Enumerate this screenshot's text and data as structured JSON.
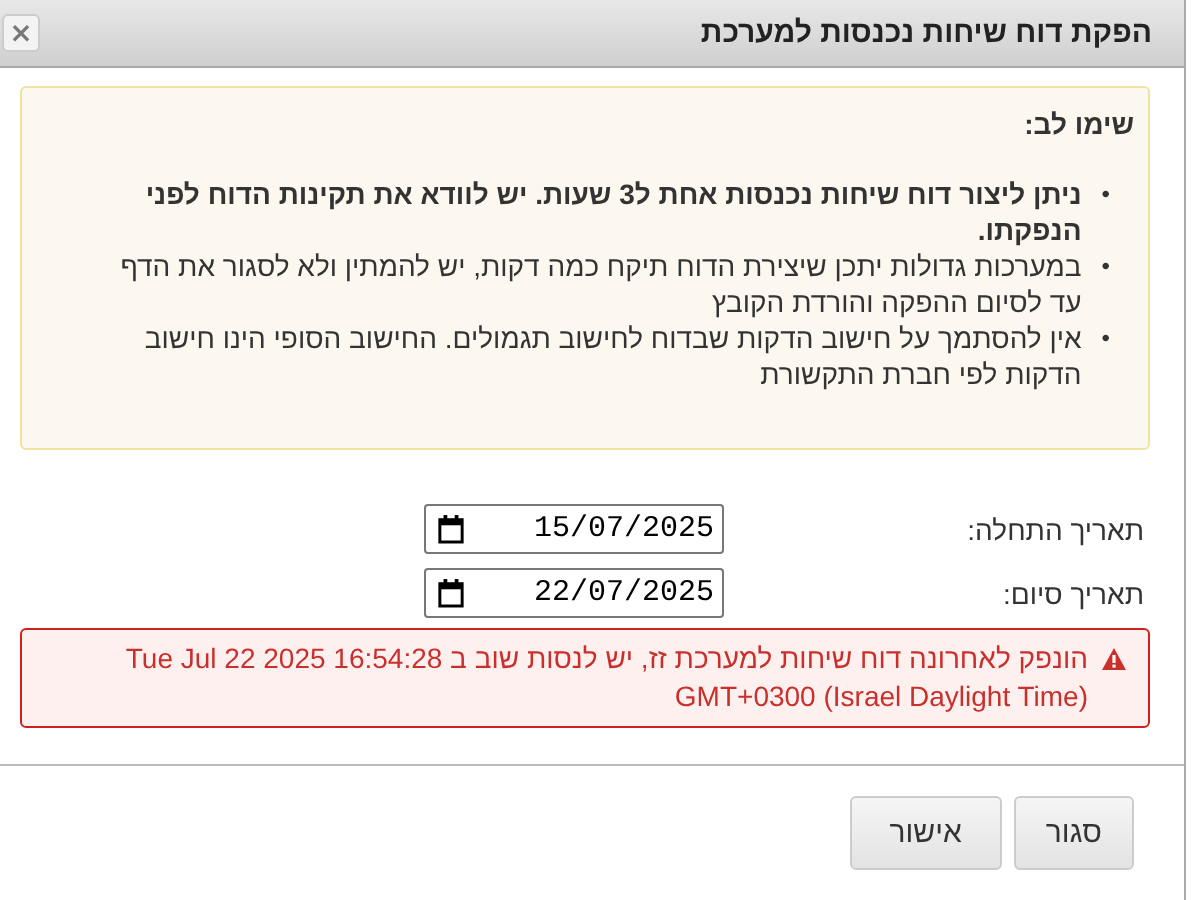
{
  "window": {
    "title": "הפקת דוח שיחות נכנסות למערכת",
    "close": "×"
  },
  "notice": {
    "heading": "שימו לב:",
    "items": [
      {
        "bullet": "•",
        "text": "ניתן ליצור דוח שיחות נכנסות אחת ל3 שעות. יש לוודא את תקינות הדוח לפני הנפקתו.",
        "bold": true
      },
      {
        "bullet": "•",
        "text": "במערכות גדולות יתכן שיצירת הדוח תיקח כמה דקות, יש להמתין ולא לסגור את הדף עד לסיום ההפקה והורדת הקובץ",
        "bold": false
      },
      {
        "bullet": "•",
        "text": "אין להסתמך על חישוב הדקות שבדוח לחישוב תגמולים. החישוב הסופי הינו חישוב הדקות לפי חברת התקשורת",
        "bold": false
      }
    ]
  },
  "fields": [
    {
      "label": "תאריך התחלה:",
      "value": "15/07/2025"
    },
    {
      "label": "תאריך סיום:",
      "value": "22/07/2025"
    }
  ],
  "error": {
    "text": "הונפק לאחרונה דוח שיחות למערכת זז, יש לנסות שוב ב Tue Jul 22 2025 16:54:28 GMT+0300 (Israel Daylight Time)"
  },
  "buttons": [
    "סגור",
    "אישור"
  ]
}
